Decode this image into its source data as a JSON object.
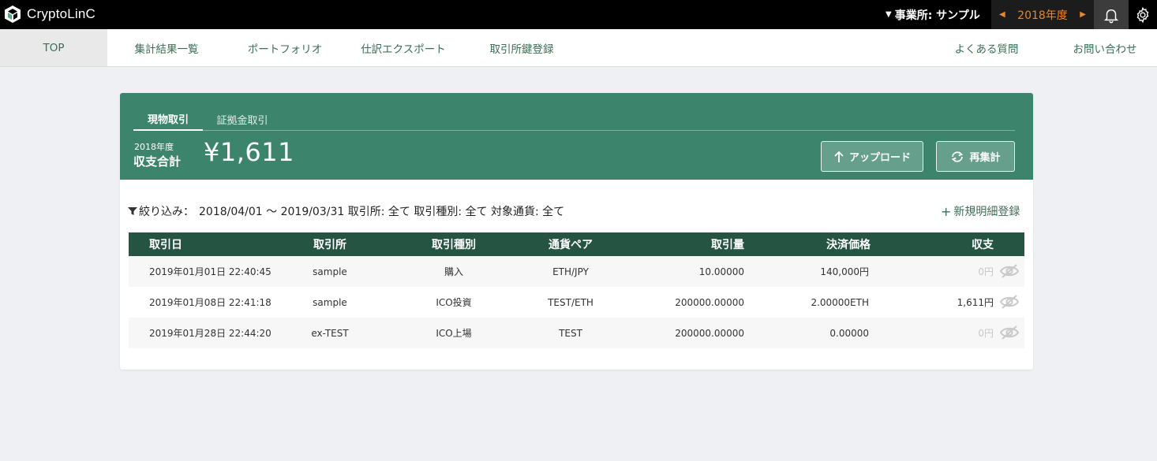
{
  "app": {
    "name": "CryptoLinC"
  },
  "topbar": {
    "office_label": "事業所: サンプル",
    "year": "2018年度",
    "prev_icon": "caret-left-icon",
    "next_icon": "caret-right-icon",
    "bell_icon": "bell-icon",
    "settings_icon": "gear-icon"
  },
  "nav": {
    "items": [
      {
        "label": "TOP",
        "active": true
      },
      {
        "label": "集計結果一覧"
      },
      {
        "label": "ポートフォリオ"
      },
      {
        "label": "仕訳エクスポート"
      },
      {
        "label": "取引所鍵登録"
      }
    ],
    "right": [
      {
        "label": "よくある質問"
      },
      {
        "label": "お問い合わせ"
      }
    ]
  },
  "card": {
    "tabs": [
      {
        "label": "現物取引"
      },
      {
        "label": "証拠金取引"
      }
    ],
    "summary": {
      "year": "2018年度",
      "label": "収支合計",
      "amount": "¥1,611"
    },
    "upload_label": "アップロード",
    "recalc_label": "再集計"
  },
  "filter": {
    "label": "絞り込み：",
    "text": "2018/04/01 〜 2019/03/31 取引所: 全て 取引種別: 全て 対象通貨: 全て"
  },
  "new_entry_label": "新規明細登録",
  "table": {
    "headers": [
      "取引日",
      "取引所",
      "取引種別",
      "通貨ペア",
      "取引量",
      "決済価格",
      "収支"
    ],
    "rows": [
      {
        "date": "2019年01月01日 22:40:45",
        "exchange": "sample",
        "type": "購入",
        "pair": "ETH/JPY",
        "amount": "10.00000",
        "price": "140,000円",
        "profit": "0円",
        "muted": true
      },
      {
        "date": "2019年01月08日 22:41:18",
        "exchange": "sample",
        "type": "ICO投資",
        "pair": "TEST/ETH",
        "amount": "200000.00000",
        "price": "2.00000ETH",
        "profit": "1,611円",
        "muted": false
      },
      {
        "date": "2019年01月28日 22:44:20",
        "exchange": "ex-TEST",
        "type": "ICO上場",
        "pair": "TEST",
        "amount": "200000.00000",
        "price": "0.00000",
        "profit": "0円",
        "muted": true
      }
    ]
  },
  "colors": {
    "brand_green": "#3c856c",
    "table_header": "#265443",
    "accent_orange": "#e8862a"
  }
}
